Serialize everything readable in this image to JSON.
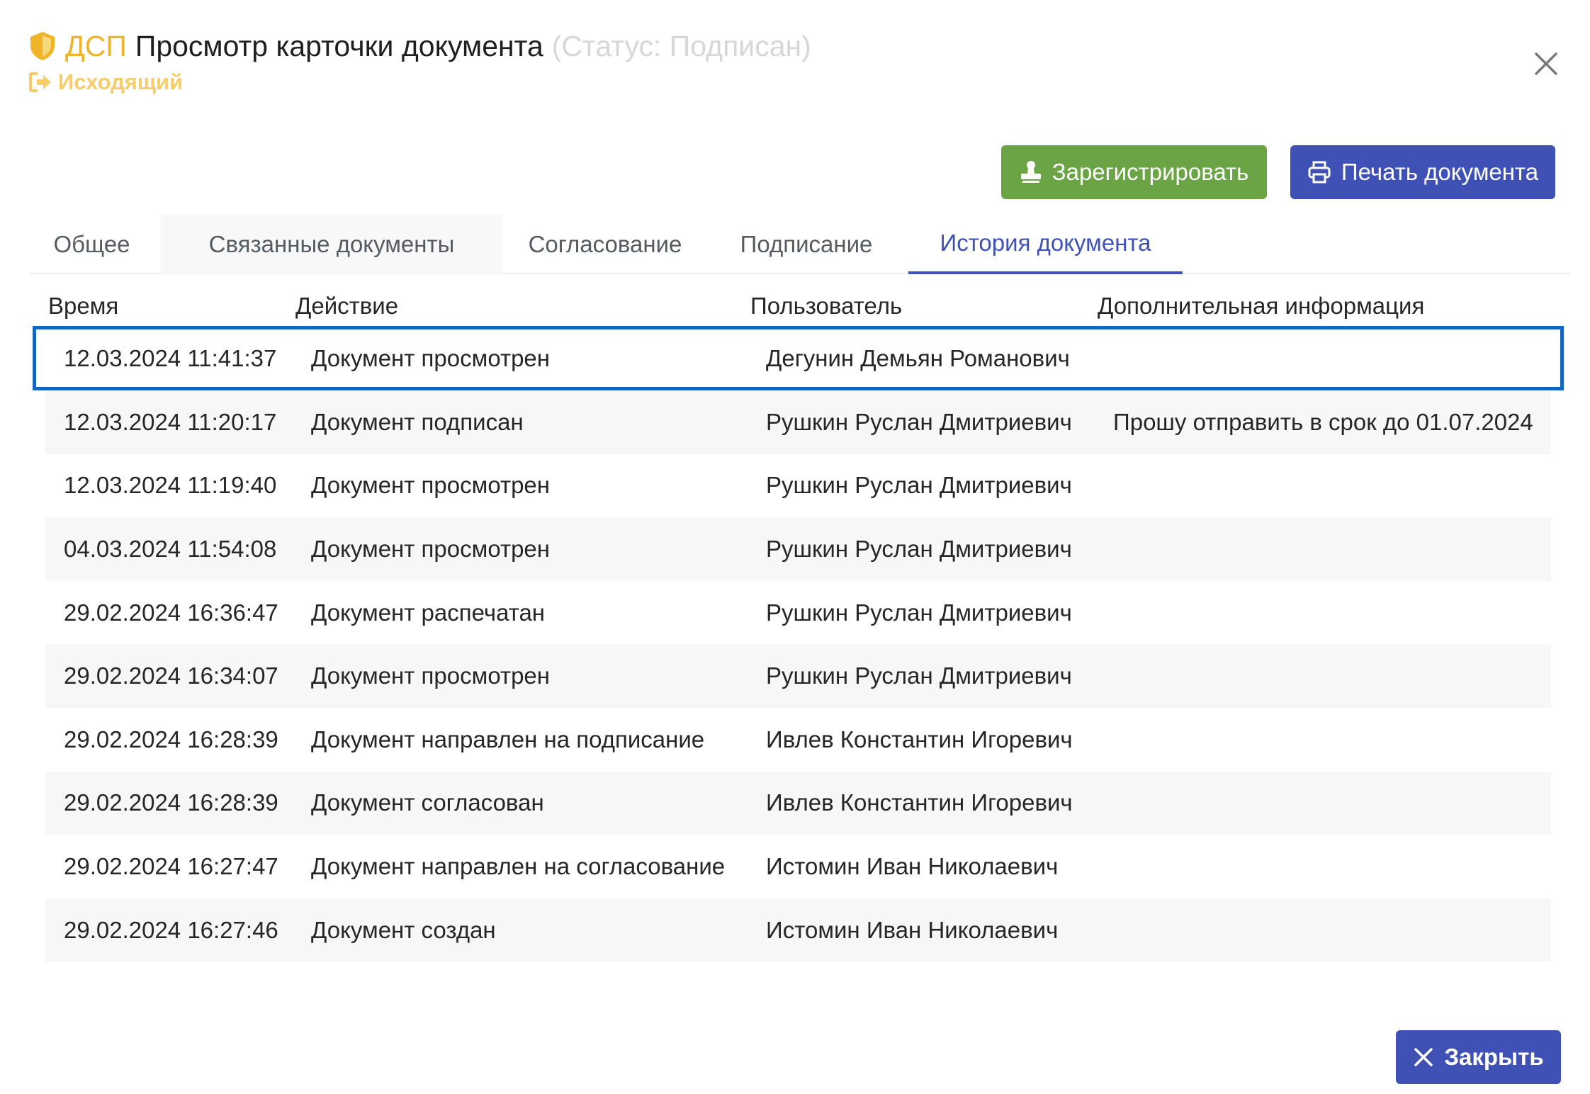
{
  "header": {
    "classification": "ДСП",
    "title": "Просмотр карточки документа",
    "status": "(Статус: Подписан)",
    "direction": "Исходящий"
  },
  "actions": {
    "register_label": "Зарегистрировать",
    "print_label": "Печать документа",
    "close_label": "Закрыть"
  },
  "tabs": [
    {
      "label": "Общее"
    },
    {
      "label": "Связанные документы"
    },
    {
      "label": "Согласование"
    },
    {
      "label": "Подписание"
    },
    {
      "label": "История документа"
    }
  ],
  "active_tab": "История документа",
  "table": {
    "columns": [
      "Время",
      "Действие",
      "Пользователь",
      "Дополнительная информация"
    ],
    "rows": [
      {
        "time": "12.03.2024 11:41:37",
        "action": "Документ просмотрен",
        "user": "Дегунин Демьян Романович",
        "info": ""
      },
      {
        "time": "12.03.2024 11:20:17",
        "action": "Документ подписан",
        "user": "Рушкин Руслан Дмитриевич",
        "info": "Прошу отправить в срок до 01.07.2024"
      },
      {
        "time": "12.03.2024 11:19:40",
        "action": "Документ просмотрен",
        "user": "Рушкин Руслан Дмитриевич",
        "info": ""
      },
      {
        "time": "04.03.2024 11:54:08",
        "action": "Документ просмотрен",
        "user": "Рушкин Руслан Дмитриевич",
        "info": ""
      },
      {
        "time": "29.02.2024 16:36:47",
        "action": "Документ распечатан",
        "user": "Рушкин Руслан Дмитриевич",
        "info": ""
      },
      {
        "time": "29.02.2024 16:34:07",
        "action": "Документ просмотрен",
        "user": "Рушкин Руслан Дмитриевич",
        "info": ""
      },
      {
        "time": "29.02.2024 16:28:39",
        "action": "Документ направлен на подписание",
        "user": "Ивлев Константин Игоревич",
        "info": ""
      },
      {
        "time": "29.02.2024 16:28:39",
        "action": "Документ согласован",
        "user": "Ивлев Константин Игоревич",
        "info": ""
      },
      {
        "time": "29.02.2024 16:27:47",
        "action": "Документ направлен на согласование",
        "user": "Истомин Иван Николаевич",
        "info": ""
      },
      {
        "time": "29.02.2024 16:27:46",
        "action": "Документ создан",
        "user": "Истомин Иван Николаевич",
        "info": ""
      }
    ]
  },
  "colors": {
    "accent": "#3f51b5",
    "success": "#6aa444",
    "classification": "#f0b429",
    "selection_border": "#1565c0"
  },
  "icons": {
    "classification": "shield-icon",
    "direction": "sign-out-icon",
    "register": "stamp-icon",
    "print": "printer-icon",
    "close": "close-icon"
  }
}
